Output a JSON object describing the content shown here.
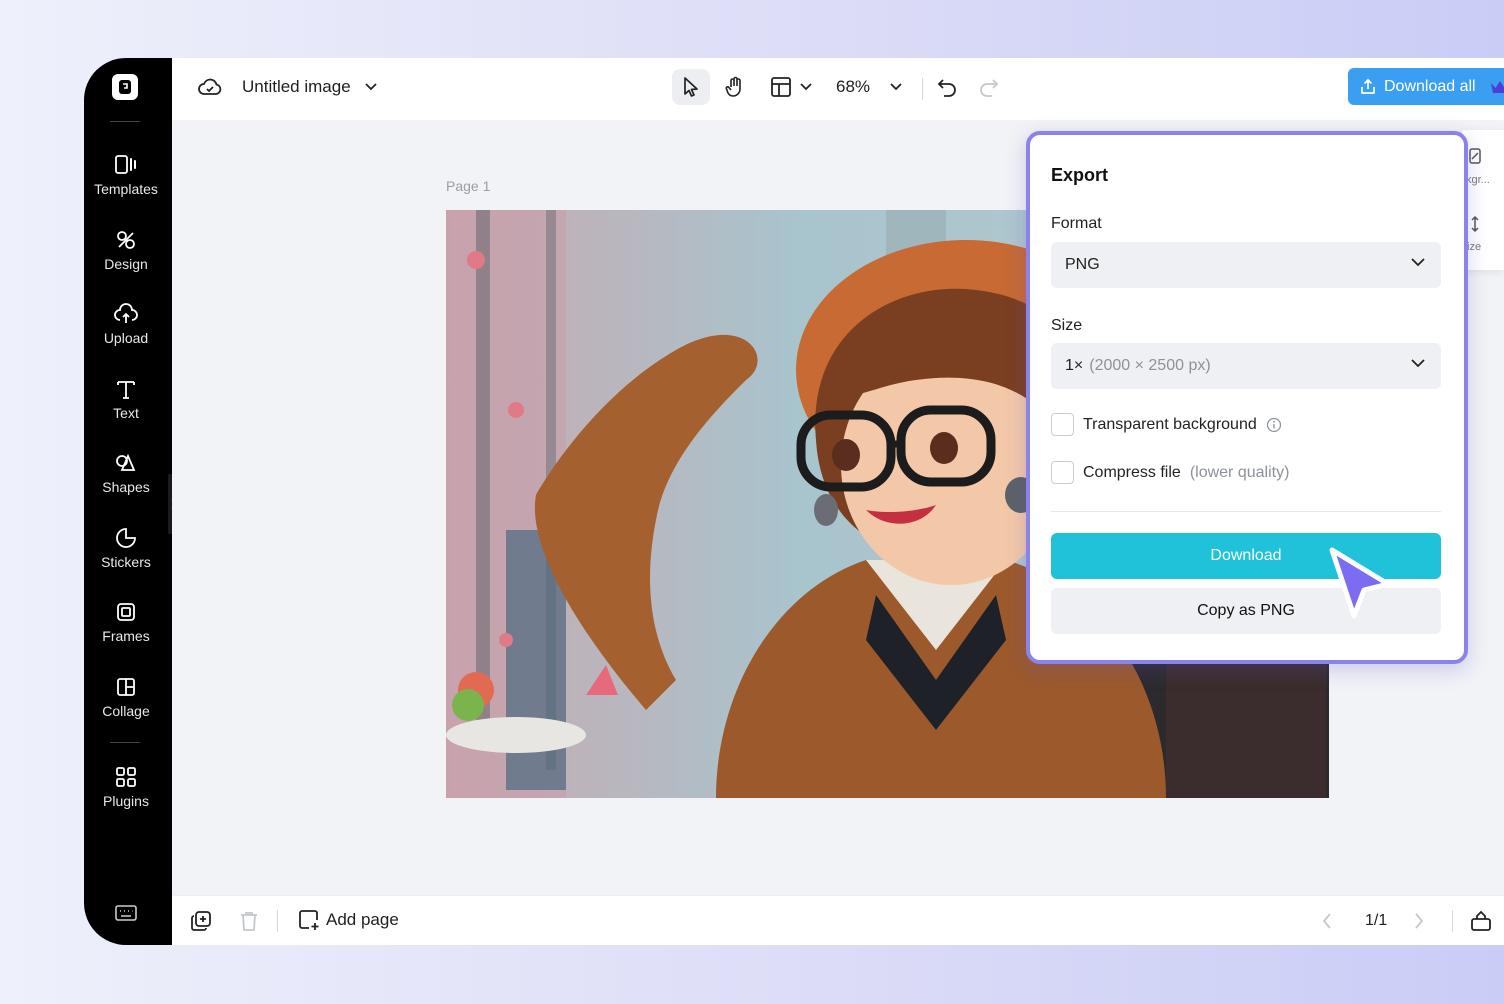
{
  "app": {
    "document_title": "Untitled image",
    "zoom": "68%",
    "download_all_label": "Download all"
  },
  "sidebar": {
    "items": [
      {
        "label": "Templates",
        "icon": "templates-icon"
      },
      {
        "label": "Design",
        "icon": "design-icon"
      },
      {
        "label": "Upload",
        "icon": "upload-icon"
      },
      {
        "label": "Text",
        "icon": "text-icon"
      },
      {
        "label": "Shapes",
        "icon": "shapes-icon"
      },
      {
        "label": "Stickers",
        "icon": "stickers-icon"
      },
      {
        "label": "Frames",
        "icon": "frames-icon"
      },
      {
        "label": "Collage",
        "icon": "collage-icon"
      },
      {
        "label": "Plugins",
        "icon": "plugins-icon"
      }
    ]
  },
  "canvas": {
    "page_label": "Page 1"
  },
  "right_panel": {
    "item1": "kgr...",
    "item2": "ize"
  },
  "export": {
    "title": "Export",
    "format_label": "Format",
    "format_value": "PNG",
    "size_label": "Size",
    "size_value": "1×",
    "size_detail": "(2000 × 2500 px)",
    "transparent_label": "Transparent background",
    "compress_label": "Compress file",
    "compress_note": "(lower quality)",
    "download_label": "Download",
    "copy_label": "Copy as PNG"
  },
  "bottombar": {
    "add_page_label": "Add page",
    "page_count": "1/1"
  },
  "colors": {
    "accent_cyan": "#1fc2d9",
    "download_all_blue": "#3a9ff0",
    "popup_border": "#8b82ee",
    "cursor_purple": "#7b6cf2"
  }
}
